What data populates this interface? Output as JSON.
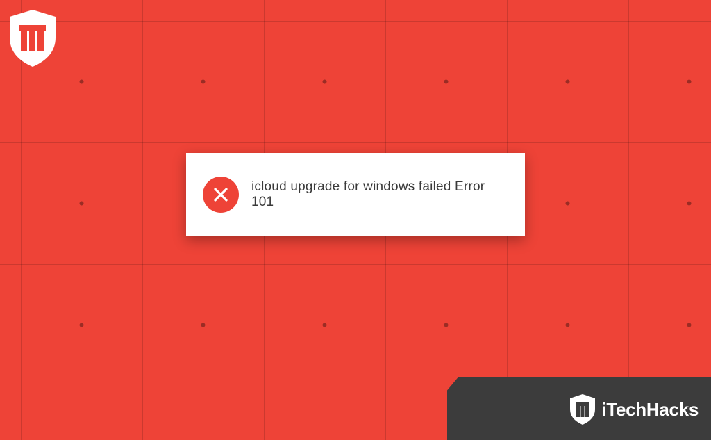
{
  "error": {
    "message": "icloud upgrade for windows failed Error 101"
  },
  "brand": {
    "name": "iTechHacks"
  },
  "colors": {
    "background": "#ee4337",
    "cardBg": "#ffffff",
    "bandBg": "#3c3c3c",
    "textDark": "#3a3a3a"
  }
}
